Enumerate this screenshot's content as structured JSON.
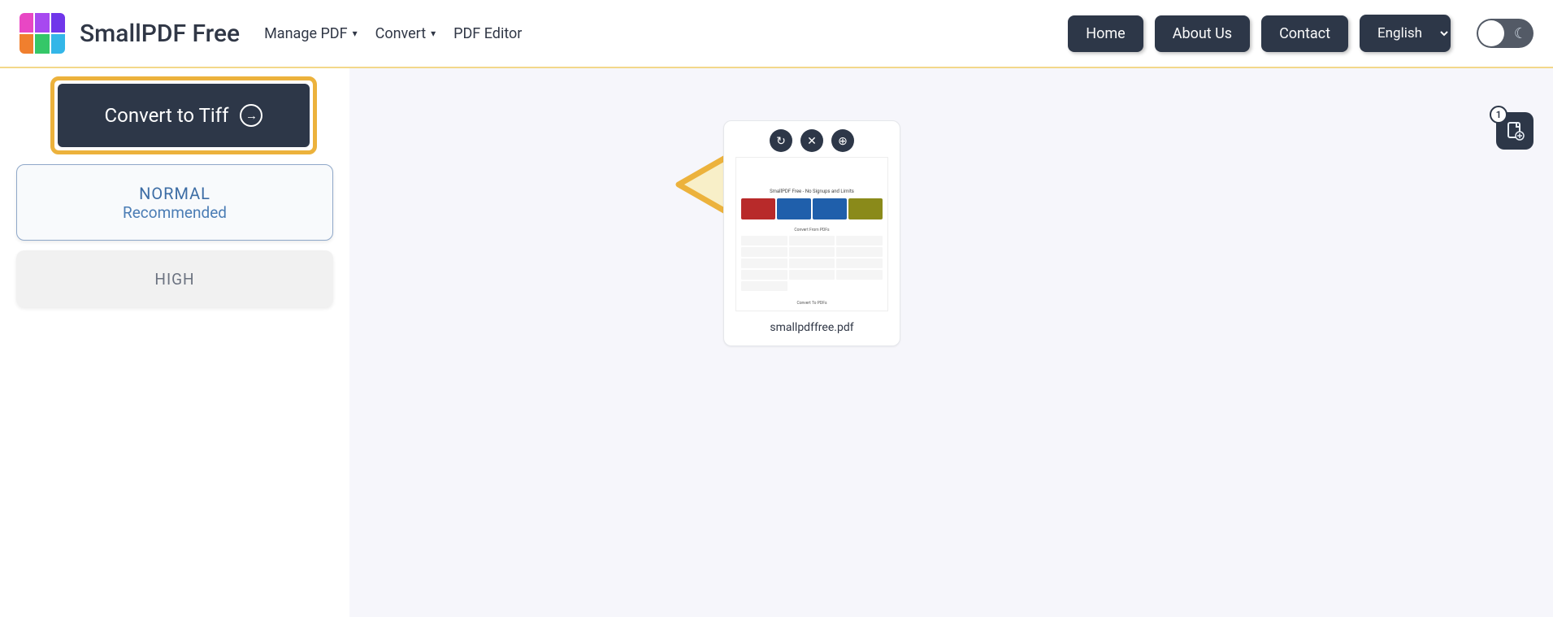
{
  "header": {
    "brand": "SmallPDF Free",
    "nav": {
      "manage": "Manage PDF",
      "convert": "Convert",
      "editor": "PDF Editor"
    },
    "right": {
      "home": "Home",
      "about": "About Us",
      "contact": "Contact",
      "language": "English"
    }
  },
  "sidebar": {
    "convert_label": "Convert to Tiff",
    "options": [
      {
        "title": "NORMAL",
        "subtitle": "Recommended",
        "selected": true
      },
      {
        "title": "HIGH",
        "subtitle": "",
        "selected": false
      }
    ]
  },
  "preview": {
    "file_name": "smallpdffree.pdf",
    "thumb_header": "SmallPDF Free - No Signups and Limits",
    "thumb_mid": "Convert From PDFs",
    "thumb_footer": "Convert To PDFs"
  },
  "fab": {
    "count": "1"
  },
  "icons": {
    "refresh": "↻",
    "close": "✕",
    "zoom": "⊕",
    "moon": "☾"
  },
  "colors": {
    "logo": [
      "#e847c4",
      "#a749f0",
      "#7036ea",
      "#f07f2e",
      "#35c768",
      "#33b6e8"
    ],
    "thumb_tiles": [
      "#b82a2a",
      "#1f5fab",
      "#1f5fab",
      "#8a8a1a"
    ]
  }
}
